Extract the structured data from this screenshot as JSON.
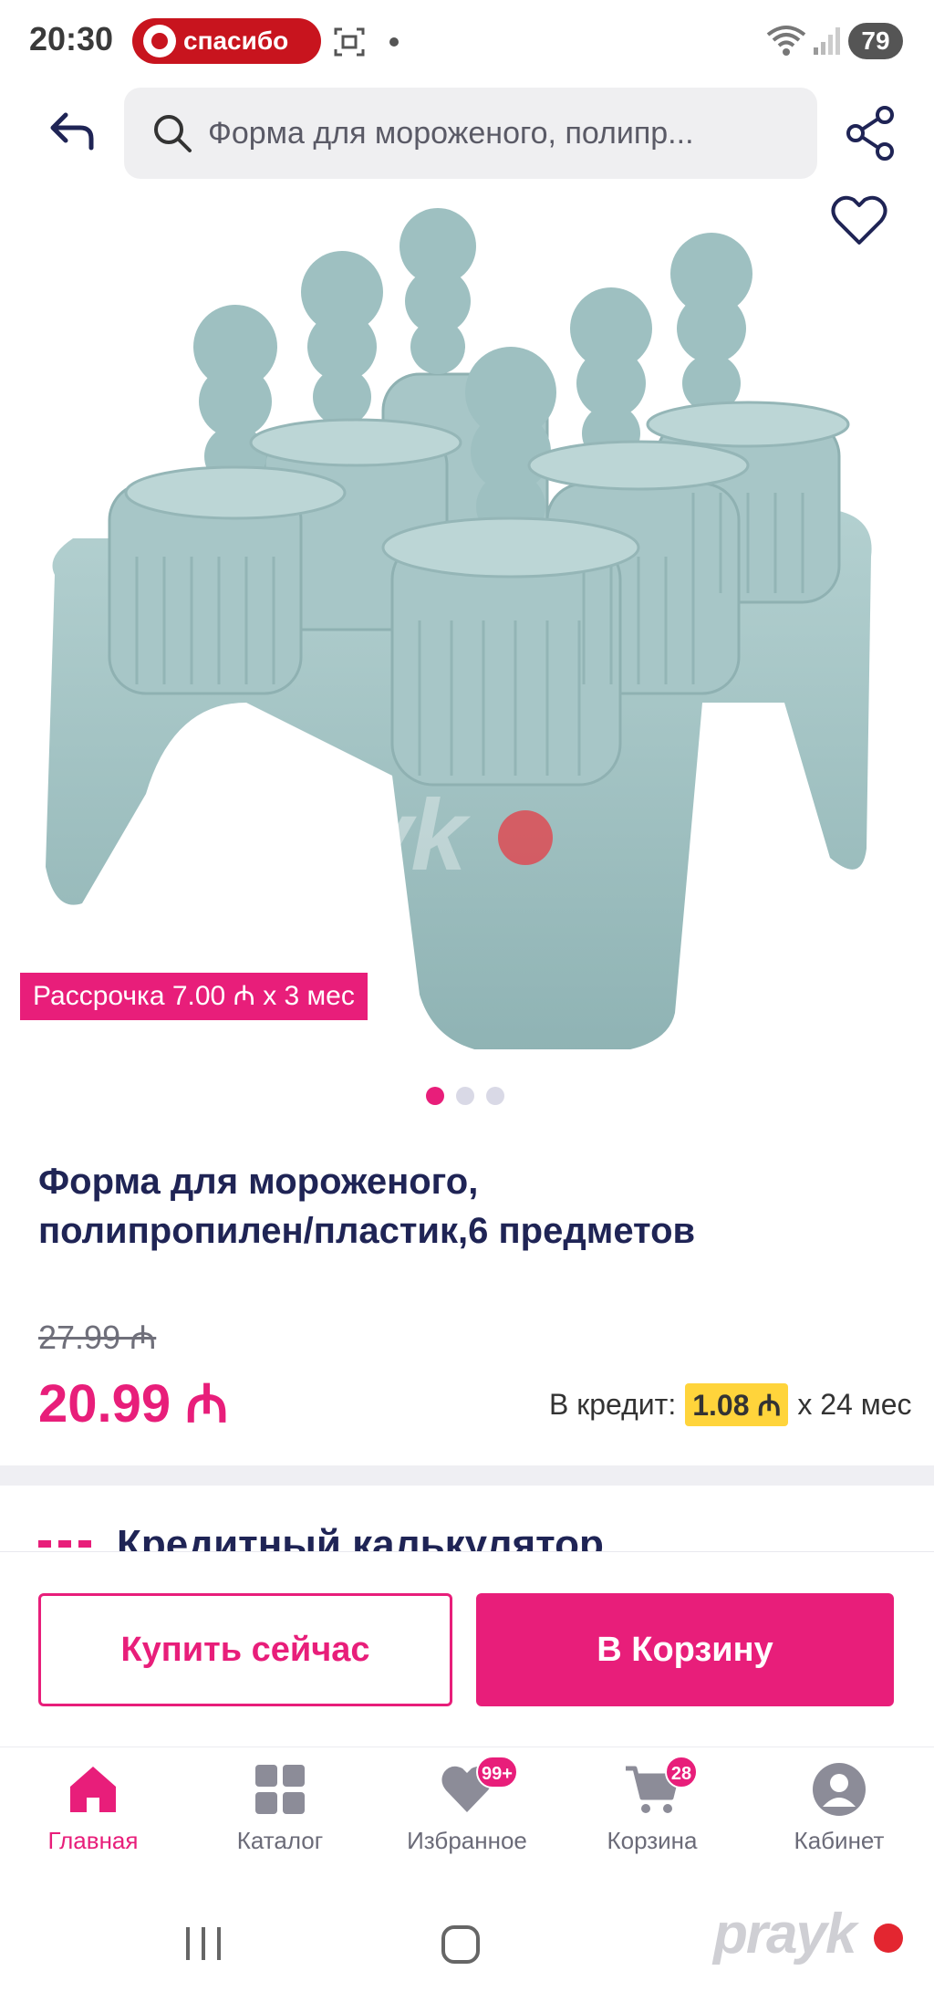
{
  "status_bar": {
    "time": "20:30",
    "promo_label": "спасибо",
    "battery": "79",
    "icons": [
      "screen-record-icon",
      "wifi-icon",
      "signal-icon"
    ]
  },
  "header": {
    "search_value": "Форма для мороженого, полипр...",
    "icons": [
      "back-arrow-icon",
      "search-icon",
      "share-icon",
      "heart-outline-icon"
    ]
  },
  "gallery": {
    "installment_badge": "Рассрочка 7.00 ₼ x 3 мес",
    "watermark": "prayk",
    "active_index": 0,
    "total": 3
  },
  "product": {
    "title_line1": "Форма для мороженого,",
    "title_line2": "полипропилен/пластик,6 предметов",
    "old_price": "27.99 ₼",
    "price": "20.99 ₼",
    "credit_label": "В кредит:",
    "credit_amount": "1.08 ₼",
    "credit_term": "x 24 мес",
    "calculator_label": "Кредитный калькулятор"
  },
  "actions": {
    "buy_now": "Купить сейчас",
    "add_to_cart": "В Корзину"
  },
  "bottom_nav": {
    "items": [
      {
        "label": "Главная",
        "icon": "home-icon",
        "active": true
      },
      {
        "label": "Каталог",
        "icon": "catalog-grid-icon"
      },
      {
        "label": "Избранное",
        "icon": "heart-icon",
        "badge": "99+"
      },
      {
        "label": "Корзина",
        "icon": "cart-icon",
        "badge": "28"
      },
      {
        "label": "Кабинет",
        "icon": "profile-icon"
      }
    ]
  },
  "watermark_corner": "prayk",
  "colors": {
    "accent": "#e81e7a",
    "title": "#1f2455",
    "credit_highlight": "#ffd43b",
    "product": "#9fc0c0"
  }
}
